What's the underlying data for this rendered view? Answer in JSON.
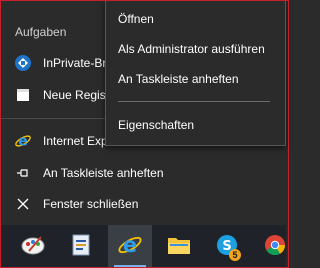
{
  "jumplist": {
    "section_title": "Aufgaben",
    "items": [
      {
        "label": "InPrivate-Browsen starten",
        "icon": "inprivate-icon"
      },
      {
        "label": "Neue Registerkarte",
        "icon": "new-tab-icon"
      }
    ],
    "app_items": [
      {
        "label": "Internet Explorer",
        "icon": "internet-explorer-icon"
      },
      {
        "label": "An Taskleiste anheften",
        "icon": "pin-icon"
      },
      {
        "label": "Fenster schließen",
        "icon": "close-icon"
      }
    ]
  },
  "context_menu": {
    "items": [
      {
        "label": "Öffnen"
      },
      {
        "label": "Als Administrator ausführen"
      },
      {
        "label": "An Taskleiste anheften"
      },
      {
        "label": "Eigenschaften"
      }
    ]
  },
  "taskbar": {
    "buttons": [
      {
        "icon": "paint-icon"
      },
      {
        "icon": "wordpad-icon"
      },
      {
        "icon": "internet-explorer-icon",
        "active": true
      },
      {
        "icon": "file-explorer-icon"
      },
      {
        "icon": "skype-icon",
        "badge": "5"
      },
      {
        "icon": "chrome-icon"
      }
    ]
  },
  "colors": {
    "background": "#2b2b2b",
    "taskbar": "#1f2329",
    "accent": "#79b2e8",
    "frame": "#c8202a",
    "badge": "#f2a21b"
  }
}
